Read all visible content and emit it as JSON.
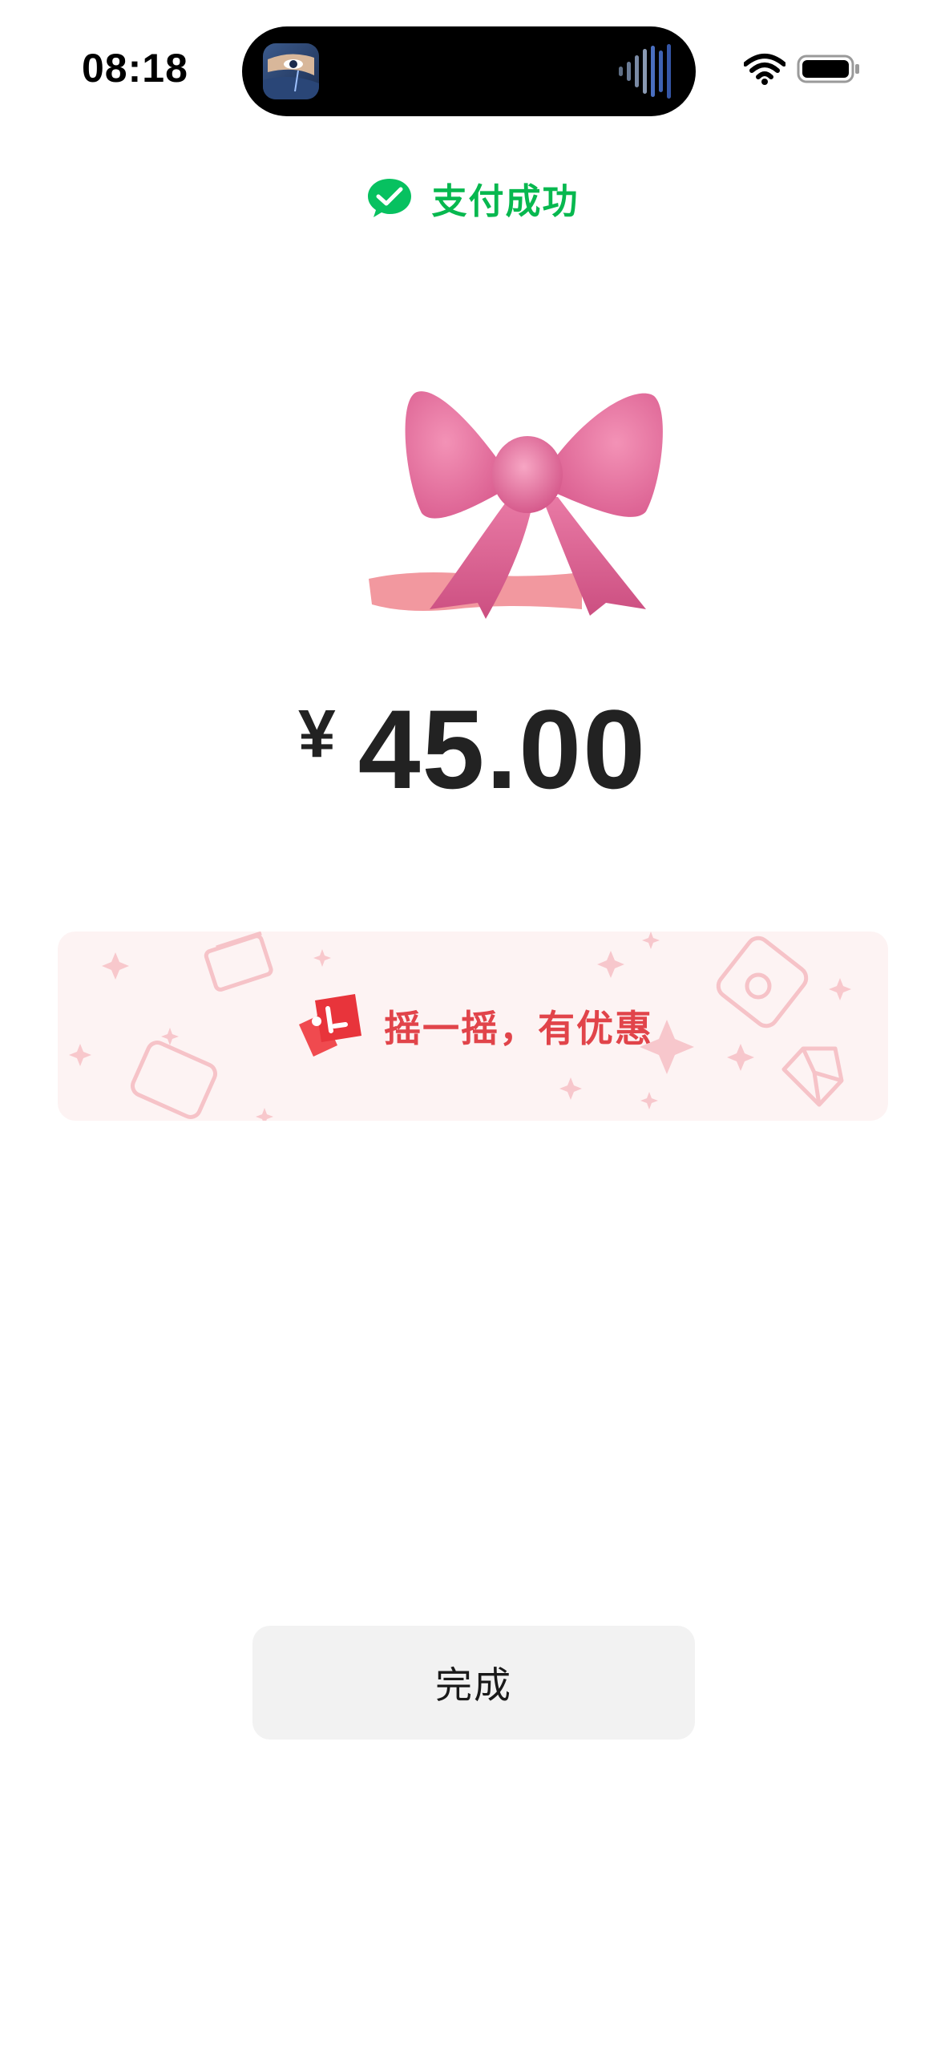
{
  "status_bar": {
    "time": "08:18",
    "island_icons": [
      "now-playing-artwork-icon",
      "audio-waveform-icon"
    ],
    "right_icons": [
      "wifi-icon",
      "battery-icon"
    ]
  },
  "header": {
    "icon": "wechat-pay-icon",
    "title": "支付成功",
    "accent_color": "#07b84f"
  },
  "sticker": {
    "icon": "pink-bow-icon"
  },
  "payment": {
    "currency_symbol": "¥",
    "amount": "45.00"
  },
  "promo_banner": {
    "icon": "red-ticket-icon",
    "text": "摇一摇，有优惠",
    "text_color": "#e1444a",
    "background_color": "#fdf3f3"
  },
  "actions": {
    "done_label": "完成"
  }
}
